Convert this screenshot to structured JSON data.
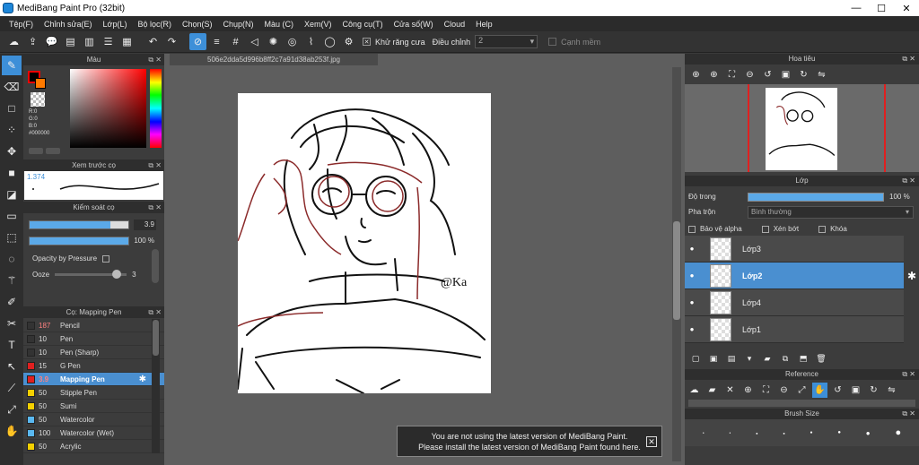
{
  "window": {
    "title": "MediBang Paint Pro (32bit)"
  },
  "menu": [
    "Tệp(F)",
    "Chỉnh sửa(E)",
    "Lớp(L)",
    "Bộ lọc(R)",
    "Chọn(S)",
    "Chụp(N)",
    "Màu (C)",
    "Xem(V)",
    "Công cụ(T)",
    "Cửa số(W)",
    "Cloud",
    "Help"
  ],
  "toolbar": {
    "antialias_label": "Khử răng cưa",
    "correction_label": "Điều chỉnh",
    "correction_value": "2",
    "sharp_edge_label": "Cạnh mềm"
  },
  "color_panel": {
    "title": "Màu",
    "r": "R:0",
    "g": "G:0",
    "b": "B:0",
    "hex": "#000000"
  },
  "preview_panel": {
    "title": "Xem trước cọ",
    "value": "1.374"
  },
  "control_panel": {
    "title": "Kiểm soát cọ",
    "size_value": "3.9",
    "size_fraction": 0.82,
    "opacity_value": "100 %",
    "opacity_fraction": 1.0,
    "pressure_label": "Opacity by Pressure",
    "ooze_label": "Ooze",
    "ooze_value": "3"
  },
  "brush_panel": {
    "title": "Cọ: Mapping Pen",
    "items": [
      {
        "size": "187",
        "name": "Pencil",
        "color": "#333333",
        "size_color": "#ff8080"
      },
      {
        "size": "10",
        "name": "Pen",
        "color": "#333333"
      },
      {
        "size": "10",
        "name": "Pen (Sharp)",
        "color": "#333333"
      },
      {
        "size": "15",
        "name": "G Pen",
        "color": "#e02020"
      },
      {
        "size": "3.9",
        "name": "Mapping Pen",
        "color": "#e02020",
        "active": true,
        "size_color": "#ff8080"
      },
      {
        "size": "50",
        "name": "Stipple Pen",
        "color": "#f4d000"
      },
      {
        "size": "50",
        "name": "Sumi",
        "color": "#f4d000"
      },
      {
        "size": "50",
        "name": "Watercolor",
        "color": "#5ab8f0"
      },
      {
        "size": "100",
        "name": "Watercolor (Wet)",
        "color": "#5ab8f0"
      },
      {
        "size": "50",
        "name": "Acrylic",
        "color": "#f4d000"
      }
    ]
  },
  "canvas": {
    "tab_title": "506e2dda5d996b8ff2c7a91d38ab253f.jpg"
  },
  "toast": {
    "line1": "You are not using the latest version of MediBang Paint.",
    "line2": "Please install the latest version of MediBang Paint found here."
  },
  "navigator": {
    "title": "Hoa tiêu"
  },
  "layer_panel": {
    "title": "Lớp",
    "opacity_label": "Độ trong",
    "opacity_value": "100 %",
    "blend_label": "Pha trộn",
    "blend_value": "Bình thường",
    "protect_alpha": "Bảo vệ alpha",
    "clipping": "Xén bớt",
    "lock": "Khóa",
    "layers": [
      {
        "name": "Lớp3"
      },
      {
        "name": "Lớp2",
        "active": true
      },
      {
        "name": "Lớp4"
      },
      {
        "name": "Lớp1"
      }
    ]
  },
  "reference_panel": {
    "title": "Reference"
  },
  "brushsize_panel": {
    "title": "Brush Size"
  }
}
